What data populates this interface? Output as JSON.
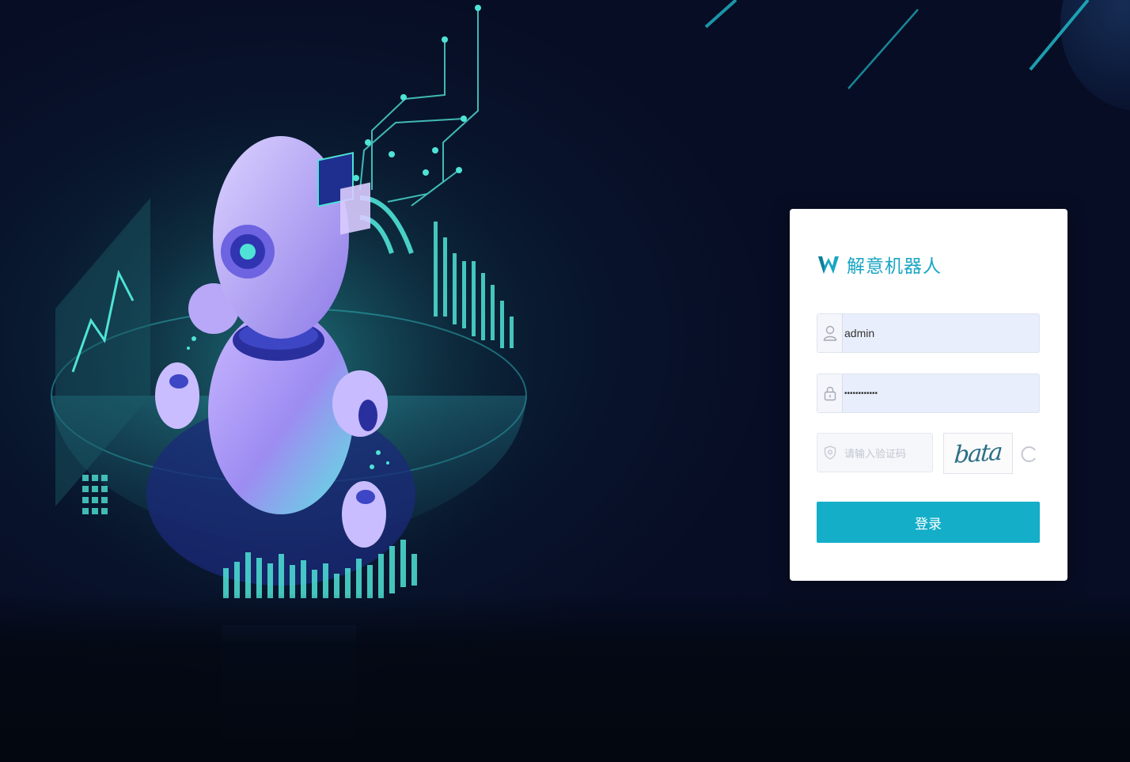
{
  "brand": {
    "logo": "w-logo-icon",
    "name": "解意机器人"
  },
  "login_form": {
    "username": {
      "icon": "user-icon",
      "value": "admin"
    },
    "password": {
      "icon": "lock-icon",
      "value": "••••••••••••"
    },
    "captcha": {
      "icon": "shield-icon",
      "placeholder": "请输入验证码",
      "image_text": "bata",
      "refresh_icon": "refresh-icon"
    },
    "submit_label": "登录"
  },
  "colors": {
    "accent": "#14aec9",
    "brand_text": "#1aa6c4",
    "background": "#070d24",
    "input_fill": "#e8eefb"
  }
}
